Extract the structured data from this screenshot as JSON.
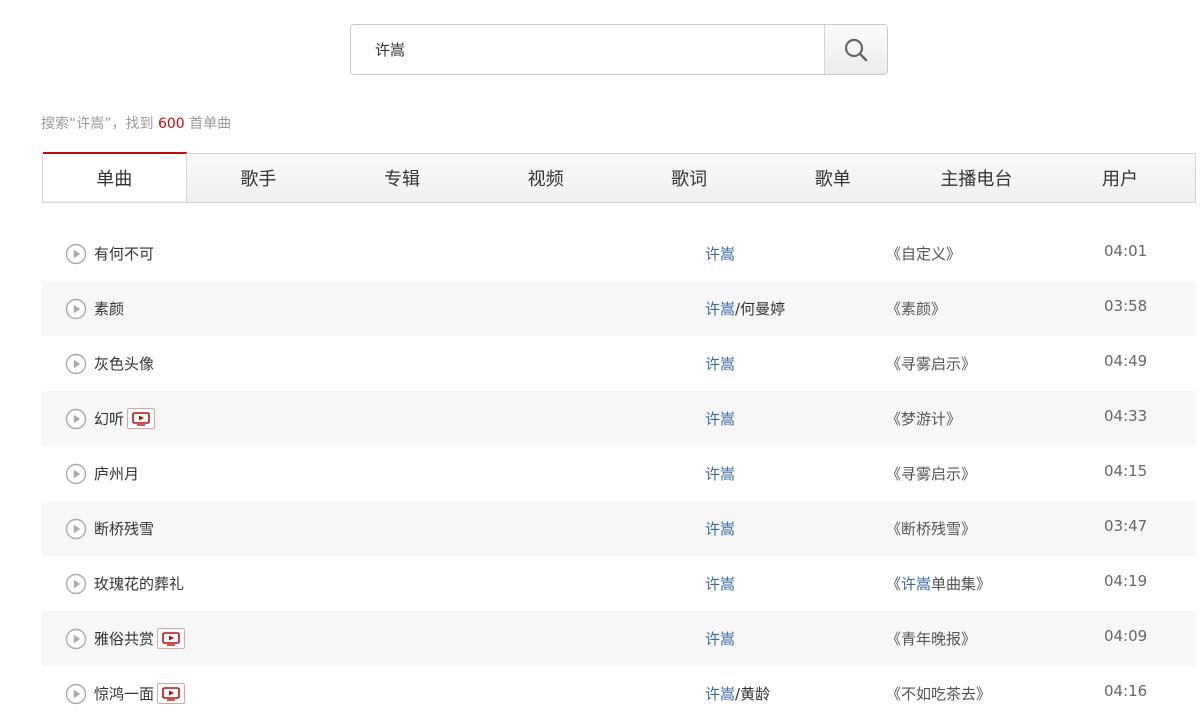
{
  "search": {
    "value": "许嵩"
  },
  "summary": {
    "prefix": "搜索“许嵩”，找到 ",
    "count": "600",
    "suffix": " 首单曲"
  },
  "tabs": [
    {
      "label": "单曲",
      "active": true
    },
    {
      "label": "歌手"
    },
    {
      "label": "专辑"
    },
    {
      "label": "视频"
    },
    {
      "label": "歌词"
    },
    {
      "label": "歌单"
    },
    {
      "label": "主播电台"
    },
    {
      "label": "用户"
    }
  ],
  "songs": [
    {
      "title": "有何不可",
      "artist": "许嵩",
      "artist2": "",
      "album": "《自定义》",
      "duration": "04:01",
      "mv": false
    },
    {
      "title": "素颜",
      "artist": "许嵩",
      "artist2": "何曼婷",
      "album": "《素颜》",
      "duration": "03:58",
      "mv": false
    },
    {
      "title": "灰色头像",
      "artist": "许嵩",
      "artist2": "",
      "album": "《寻雾启示》",
      "duration": "04:49",
      "mv": false
    },
    {
      "title": "幻听",
      "artist": "许嵩",
      "artist2": "",
      "album": "《梦游计》",
      "duration": "04:33",
      "mv": true
    },
    {
      "title": "庐州月",
      "artist": "许嵩",
      "artist2": "",
      "album": "《寻雾启示》",
      "duration": "04:15",
      "mv": false
    },
    {
      "title": "断桥残雪",
      "artist": "许嵩",
      "artist2": "",
      "album": "《断桥残雪》",
      "duration": "03:47",
      "mv": false
    },
    {
      "title": "玫瑰花的葬礼",
      "artist": "许嵩",
      "artist2": "",
      "album_pre": "《",
      "album_hl": "许嵩",
      "album_post": "单曲集》",
      "duration": "04:19",
      "mv": false
    },
    {
      "title": "雅俗共赏",
      "artist": "许嵩",
      "artist2": "",
      "album": "《青年晚报》",
      "duration": "04:09",
      "mv": true
    },
    {
      "title": "惊鸿一面",
      "artist": "许嵩",
      "artist2": "黄龄",
      "album": "《不如吃茶去》",
      "duration": "04:16",
      "mv": true
    }
  ],
  "icons": {
    "search": "search-icon",
    "play": "play-circle-icon",
    "mv": "mv-video-icon"
  },
  "colors": {
    "accent": "#c20c0c",
    "link": "#3b6aa0"
  }
}
